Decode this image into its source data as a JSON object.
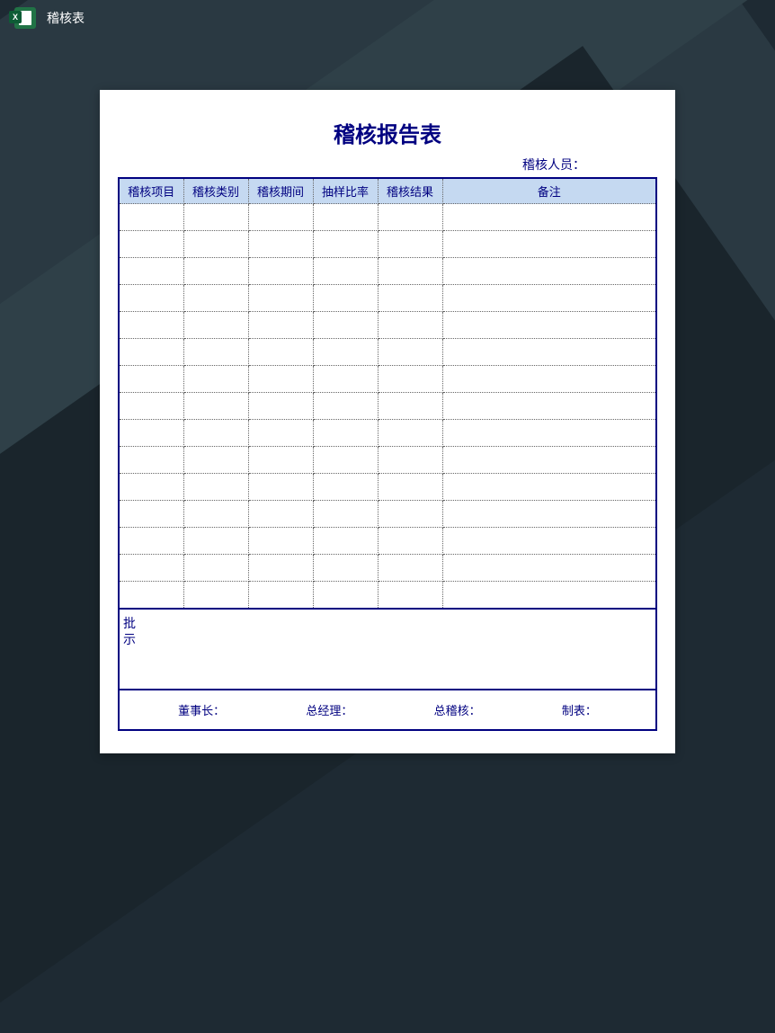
{
  "header": {
    "filename": "稽核表"
  },
  "document": {
    "title": "稽核报告表",
    "auditor_label": "稽核人员：",
    "columns": {
      "col1": "稽核项目",
      "col2": "稽核类别",
      "col3": "稽核期间",
      "col4": "抽样比率",
      "col5": "稽核结果",
      "col6": "备注"
    },
    "approval_label": "批示",
    "signatures": {
      "chairman": "董事长：",
      "general_manager": "总经理：",
      "chief_auditor": "总稽核：",
      "prepared_by": "制表："
    }
  }
}
